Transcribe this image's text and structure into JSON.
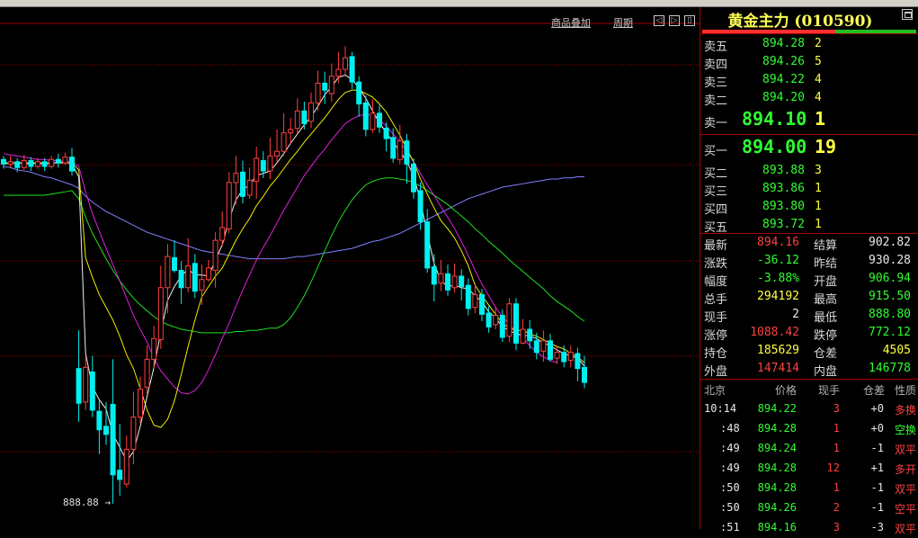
{
  "colors": {
    "up": "#ff4040",
    "down": "#00f0f0",
    "ma5": "#f0f0f0",
    "ma10": "#f0f000",
    "ma20": "#e020e0",
    "ma40": "#20e020",
    "ma60": "#8080ff",
    "grid": "#a00000"
  },
  "toolbar": {
    "overlay_label": "商品叠加",
    "period_label": "周期",
    "btn_prev": "◁",
    "btn_next": "▷",
    "btn_panel": "▯"
  },
  "chart": {
    "min_price_label": "888.88"
  },
  "chart_data": {
    "type": "candlestick",
    "ylim": [
      888.0,
      932.0
    ],
    "candles": [
      [
        919.6,
        919.2,
        919.9,
        918.8
      ],
      [
        919.2,
        919.4,
        919.9,
        918.9
      ],
      [
        919.4,
        918.9,
        919.7,
        918.5
      ],
      [
        918.9,
        919.5,
        920.0,
        918.7
      ],
      [
        919.5,
        919.0,
        919.8,
        918.6
      ],
      [
        919.0,
        919.4,
        919.7,
        918.8
      ],
      [
        919.4,
        919.0,
        919.7,
        918.6
      ],
      [
        919.0,
        919.6,
        919.9,
        918.8
      ],
      [
        919.6,
        919.3,
        920.1,
        918.9
      ],
      [
        919.3,
        919.8,
        920.2,
        919.1
      ],
      [
        919.8,
        918.6,
        920.6,
        918.2
      ],
      [
        901.5,
        898.5,
        904.8,
        896.9
      ],
      [
        898.6,
        901.6,
        902.5,
        897.9
      ],
      [
        901.2,
        897.9,
        902.6,
        897.3
      ],
      [
        897.8,
        896.2,
        898.9,
        894.1
      ],
      [
        896.5,
        895.8,
        898.6,
        894.9
      ],
      [
        898.4,
        892.3,
        902.3,
        889.8
      ],
      [
        892.7,
        891.9,
        896.7,
        890.5
      ],
      [
        891.5,
        894.5,
        895.7,
        891.2
      ],
      [
        894.5,
        897.3,
        899.5,
        893.2
      ],
      [
        897.3,
        899.7,
        900.8,
        896.8
      ],
      [
        899.9,
        902.3,
        903.5,
        899.2
      ],
      [
        902.3,
        904.1,
        905.2,
        901.5
      ],
      [
        904.0,
        908.5,
        910.4,
        903.2
      ],
      [
        908.5,
        911.2,
        912.3,
        906.3
      ],
      [
        911.1,
        910.0,
        912.6,
        909.8
      ],
      [
        910.0,
        908.5,
        910.8,
        907.1
      ],
      [
        908.5,
        910.4,
        912.8,
        908.1
      ],
      [
        910.6,
        908.2,
        911.4,
        907.6
      ],
      [
        908.3,
        909.2,
        910.5,
        907.0
      ],
      [
        909.2,
        910.2,
        910.9,
        909.0
      ],
      [
        910.0,
        912.6,
        913.3,
        908.5
      ],
      [
        912.6,
        913.7,
        915.1,
        912.1
      ],
      [
        913.6,
        917.6,
        918.5,
        913.2
      ],
      [
        917.6,
        918.4,
        919.9,
        915.7
      ],
      [
        918.5,
        916.4,
        919.5,
        915.8
      ],
      [
        916.5,
        917.8,
        918.9,
        916.2
      ],
      [
        917.7,
        919.7,
        920.7,
        916.2
      ],
      [
        919.5,
        918.6,
        920.3,
        918.0
      ],
      [
        918.6,
        919.9,
        921.5,
        917.9
      ],
      [
        919.9,
        920.3,
        922.2,
        919.3
      ],
      [
        920.3,
        921.9,
        923.6,
        919.9
      ],
      [
        921.9,
        922.2,
        923.2,
        920.9
      ],
      [
        922.3,
        923.8,
        924.9,
        921.8
      ],
      [
        923.8,
        922.7,
        924.6,
        922.2
      ],
      [
        922.9,
        924.5,
        925.4,
        922.3
      ],
      [
        924.5,
        926.2,
        927.3,
        923.8
      ],
      [
        926.2,
        925.6,
        927.2,
        924.4
      ],
      [
        925.3,
        926.8,
        927.9,
        924.6
      ],
      [
        926.8,
        927.4,
        928.9,
        926.2
      ],
      [
        927.4,
        928.4,
        929.4,
        926.9
      ],
      [
        928.5,
        926.3,
        928.9,
        925.7
      ],
      [
        926.3,
        924.4,
        926.8,
        923.3
      ],
      [
        924.5,
        922.2,
        925.1,
        921.6
      ],
      [
        922.2,
        923.6,
        924.8,
        921.9
      ],
      [
        923.6,
        922.4,
        924.3,
        921.9
      ],
      [
        922.3,
        921.4,
        922.8,
        920.3
      ],
      [
        921.5,
        919.7,
        922.3,
        919.3
      ],
      [
        919.6,
        921.2,
        922.6,
        919.2
      ],
      [
        921.2,
        919.2,
        921.8,
        917.5
      ],
      [
        919.2,
        916.8,
        919.7,
        916.2
      ],
      [
        916.9,
        914.2,
        917.6,
        913.5
      ],
      [
        914.2,
        910.2,
        915.3,
        909.8
      ],
      [
        910.3,
        908.8,
        911.4,
        907.3
      ],
      [
        908.9,
        909.7,
        910.9,
        908.2
      ],
      [
        909.7,
        908.3,
        910.5,
        907.8
      ],
      [
        908.5,
        909.5,
        910.6,
        908.1
      ],
      [
        909.5,
        908.6,
        910.1,
        907.4
      ],
      [
        908.7,
        906.7,
        909.3,
        906.1
      ],
      [
        906.8,
        907.9,
        908.9,
        906.3
      ],
      [
        907.9,
        906.2,
        908.4,
        905.6
      ],
      [
        906.3,
        905.1,
        906.9,
        904.6
      ],
      [
        905.3,
        906.1,
        906.8,
        904.9
      ],
      [
        906.1,
        904.2,
        906.6,
        903.8
      ],
      [
        904.3,
        907.1,
        907.6,
        903.8
      ],
      [
        907.1,
        903.7,
        907.6,
        903.1
      ],
      [
        903.7,
        904.9,
        905.8,
        903.6
      ],
      [
        904.9,
        903.9,
        905.7,
        903.2
      ],
      [
        903.9,
        902.9,
        904.6,
        902.3
      ],
      [
        903.0,
        903.9,
        904.8,
        902.1
      ],
      [
        903.9,
        902.3,
        904.5,
        902.1
      ],
      [
        902.4,
        902.9,
        903.5,
        901.9
      ],
      [
        902.9,
        902.1,
        903.5,
        901.6
      ],
      [
        902.2,
        902.9,
        903.5,
        901.6
      ],
      [
        902.8,
        901.5,
        903.3,
        900.4
      ],
      [
        901.6,
        900.3,
        902.6,
        899.8
      ]
    ],
    "moving_averages": {
      "ma5": [
        919.2,
        919.3,
        919.3,
        919.3,
        919.2,
        919.3,
        919.2,
        919.3,
        919.3,
        919.4,
        919.2,
        918.1,
        902.8,
        899.9,
        898.8,
        898.0,
        895.8,
        894.7,
        893.5,
        894.3,
        896.5,
        899.1,
        901.6,
        904.6,
        907.4,
        908.6,
        909.5,
        910.1,
        909.6,
        909.6,
        909.5,
        910.9,
        912.2,
        914.4,
        916.1,
        917.0,
        917.4,
        918.2,
        918.4,
        918.6,
        919.3,
        920.1,
        921.0,
        921.8,
        922.6,
        923.3,
        924.2,
        925.2,
        925.9,
        926.7,
        926.9,
        926.5,
        925.8,
        924.9,
        923.8,
        922.8,
        921.9,
        921.1,
        920.3,
        919.4,
        918.2,
        916.0,
        913.2,
        910.6,
        909.1,
        908.6,
        908.7,
        908.5,
        908.4,
        907.8,
        907.3,
        906.4,
        905.9,
        905.1,
        904.8,
        904.5,
        904.4,
        904.3,
        904.1,
        903.7,
        903.5,
        903.1,
        902.8,
        902.6,
        902.4,
        901.7
      ],
      "ma10": [
        919.3,
        919.3,
        919.3,
        919.3,
        919.3,
        919.3,
        919.3,
        919.3,
        919.3,
        919.3,
        919.3,
        918.7,
        911.1,
        909.4,
        907.9,
        906.8,
        905.7,
        904.3,
        902.7,
        901.5,
        899.8,
        897.9,
        896.6,
        896.4,
        897.1,
        898.7,
        901.0,
        903.4,
        905.7,
        907.7,
        908.6,
        909.5,
        910.2,
        911.4,
        912.6,
        913.6,
        914.5,
        915.6,
        916.4,
        917.3,
        918.0,
        918.8,
        919.6,
        920.3,
        921.1,
        921.8,
        922.5,
        923.2,
        924.0,
        924.8,
        925.4,
        925.6,
        925.6,
        925.3,
        925.0,
        924.4,
        923.7,
        922.7,
        921.7,
        920.5,
        919.4,
        917.9,
        916.6,
        915.4,
        914.3,
        913.6,
        912.8,
        911.7,
        910.4,
        908.7,
        907.8,
        907.0,
        906.2,
        905.4,
        905.0,
        904.8,
        904.8,
        904.5,
        904.3,
        904.0,
        903.7,
        903.4,
        903.2,
        902.8,
        902.5,
        902.0
      ],
      "ma20": [
        920.1,
        920.0,
        919.9,
        919.8,
        919.7,
        919.6,
        919.6,
        919.5,
        919.5,
        919.4,
        919.4,
        919.0,
        916.8,
        914.9,
        913.4,
        911.9,
        910.5,
        909.1,
        907.6,
        906.1,
        904.9,
        903.8,
        902.4,
        901.3,
        900.6,
        899.9,
        899.4,
        899.3,
        899.6,
        900.3,
        901.4,
        902.7,
        904.1,
        905.4,
        906.9,
        908.3,
        909.6,
        910.9,
        912.0,
        913.0,
        914.1,
        915.2,
        916.2,
        917.2,
        918.2,
        919.0,
        919.8,
        920.5,
        921.3,
        922.0,
        922.7,
        923.1,
        923.4,
        923.5,
        923.4,
        923.0,
        922.5,
        921.8,
        921.1,
        920.3,
        919.4,
        918.4,
        917.4,
        916.5,
        915.5,
        914.6,
        913.6,
        912.5,
        911.3,
        910.0,
        908.8,
        907.8,
        906.8,
        906.0,
        905.3,
        904.7,
        904.1,
        903.5,
        902.9,
        902.5,
        902.2,
        902.0
      ],
      "ma40": [
        916.5,
        916.5,
        916.5,
        916.5,
        916.5,
        916.5,
        916.5,
        916.6,
        916.7,
        916.8,
        916.9,
        916.2,
        914.6,
        913.2,
        912.1,
        911.0,
        910.0,
        909.1,
        908.3,
        907.6,
        907.0,
        906.5,
        906.0,
        905.6,
        905.3,
        905.1,
        904.9,
        904.8,
        904.7,
        904.6,
        904.6,
        904.6,
        904.6,
        904.6,
        904.7,
        904.7,
        904.8,
        904.8,
        904.9,
        905.0,
        905.0,
        905.3,
        905.9,
        906.8,
        907.8,
        909.0,
        910.3,
        911.7,
        913.0,
        914.2,
        915.2,
        916.1,
        916.8,
        917.4,
        917.7,
        917.9,
        918.0,
        918.0,
        917.9,
        917.8,
        917.6,
        917.3,
        916.9,
        916.5,
        916.1,
        915.7,
        915.2,
        914.7,
        914.2,
        913.6,
        913.1,
        912.5,
        912.0,
        911.5,
        910.9,
        910.4,
        909.9,
        909.4,
        908.9,
        908.4,
        907.8,
        907.3,
        906.9,
        906.5,
        906.0,
        905.6
      ],
      "ma60": [
        919.0,
        918.9,
        918.7,
        918.6,
        918.5,
        918.3,
        918.1,
        918.0,
        917.8,
        917.6,
        917.4,
        917.1,
        916.4,
        915.9,
        915.5,
        915.1,
        914.8,
        914.5,
        914.2,
        913.9,
        913.6,
        913.3,
        913.1,
        912.9,
        912.7,
        912.5,
        912.3,
        912.1,
        911.9,
        911.7,
        911.6,
        911.5,
        911.4,
        911.3,
        911.2,
        911.1,
        911.0,
        911.0,
        911.0,
        911.0,
        911.0,
        911.0,
        911.1,
        911.2,
        911.2,
        911.3,
        911.4,
        911.5,
        911.6,
        911.7,
        911.8,
        911.9,
        912.1,
        912.3,
        912.5,
        912.6,
        912.8,
        913.0,
        913.2,
        913.5,
        913.8,
        914.1,
        914.4,
        914.7,
        915.0,
        915.3,
        915.6,
        915.9,
        916.2,
        916.4,
        916.6,
        916.8,
        917.0,
        917.2,
        917.3,
        917.4,
        917.5,
        917.6,
        917.7,
        917.8,
        917.9,
        917.9,
        918.0,
        918.0,
        918.1,
        918.1
      ]
    }
  },
  "panel": {
    "title": "黄金主力 (010590)",
    "ratio_sell_fraction": 0.62,
    "asks": [
      {
        "label": "卖五",
        "price": "894.28",
        "vol": "2"
      },
      {
        "label": "卖四",
        "price": "894.26",
        "vol": "5"
      },
      {
        "label": "卖三",
        "price": "894.22",
        "vol": "4"
      },
      {
        "label": "卖二",
        "price": "894.20",
        "vol": "4"
      },
      {
        "label": "卖一",
        "price": "894.10",
        "vol": "1"
      }
    ],
    "bids": [
      {
        "label": "买一",
        "price": "894.00",
        "vol": "19"
      },
      {
        "label": "买二",
        "price": "893.88",
        "vol": "3"
      },
      {
        "label": "买三",
        "price": "893.86",
        "vol": "1"
      },
      {
        "label": "买四",
        "price": "893.80",
        "vol": "1"
      },
      {
        "label": "买五",
        "price": "893.72",
        "vol": "1"
      }
    ],
    "stats": [
      {
        "l1": "最新",
        "v1": "894.16",
        "c1": "red",
        "l2": "结算",
        "v2": "902.82",
        "c2": "white"
      },
      {
        "l1": "涨跌",
        "v1": "-36.12",
        "c1": "green",
        "l2": "昨结",
        "v2": "930.28",
        "c2": "white"
      },
      {
        "l1": "幅度",
        "v1": "-3.88%",
        "c1": "green",
        "l2": "开盘",
        "v2": "906.94",
        "c2": "green"
      },
      {
        "l1": "总手",
        "v1": "294192",
        "c1": "yellow",
        "l2": "最高",
        "v2": "915.50",
        "c2": "green"
      },
      {
        "l1": "现手",
        "v1": "2",
        "c1": "white",
        "l2": "最低",
        "v2": "888.80",
        "c2": "green"
      },
      {
        "l1": "涨停",
        "v1": "1088.42",
        "c1": "red",
        "l2": "跌停",
        "v2": "772.12",
        "c2": "green"
      },
      {
        "l1": "持仓",
        "v1": "185629",
        "c1": "yellow",
        "l2": "仓差",
        "v2": "4505",
        "c2": "yellow"
      },
      {
        "l1": "外盘",
        "v1": "147414",
        "c1": "red",
        "l2": "内盘",
        "v2": "146778",
        "c2": "green"
      }
    ],
    "tick_headers": [
      "北京",
      "价格",
      "现手",
      "仓差",
      "性质"
    ],
    "ticks": [
      {
        "time": "10:14",
        "price": "894.22",
        "vol": "3",
        "oi": "+0",
        "nature": "多换",
        "c": "red"
      },
      {
        "time": ":48",
        "price": "894.28",
        "vol": "1",
        "oi": "+0",
        "nature": "空换",
        "c": "green"
      },
      {
        "time": ":49",
        "price": "894.24",
        "vol": "1",
        "oi": "-1",
        "nature": "双平",
        "c": "red"
      },
      {
        "time": ":49",
        "price": "894.28",
        "vol": "12",
        "oi": "+1",
        "nature": "多开",
        "c": "red"
      },
      {
        "time": ":50",
        "price": "894.28",
        "vol": "1",
        "oi": "-1",
        "nature": "双平",
        "c": "red"
      },
      {
        "time": ":50",
        "price": "894.26",
        "vol": "2",
        "oi": "-1",
        "nature": "空平",
        "c": "red"
      },
      {
        "time": ":51",
        "price": "894.16",
        "vol": "3",
        "oi": "-3",
        "nature": "双平",
        "c": "red"
      }
    ]
  }
}
